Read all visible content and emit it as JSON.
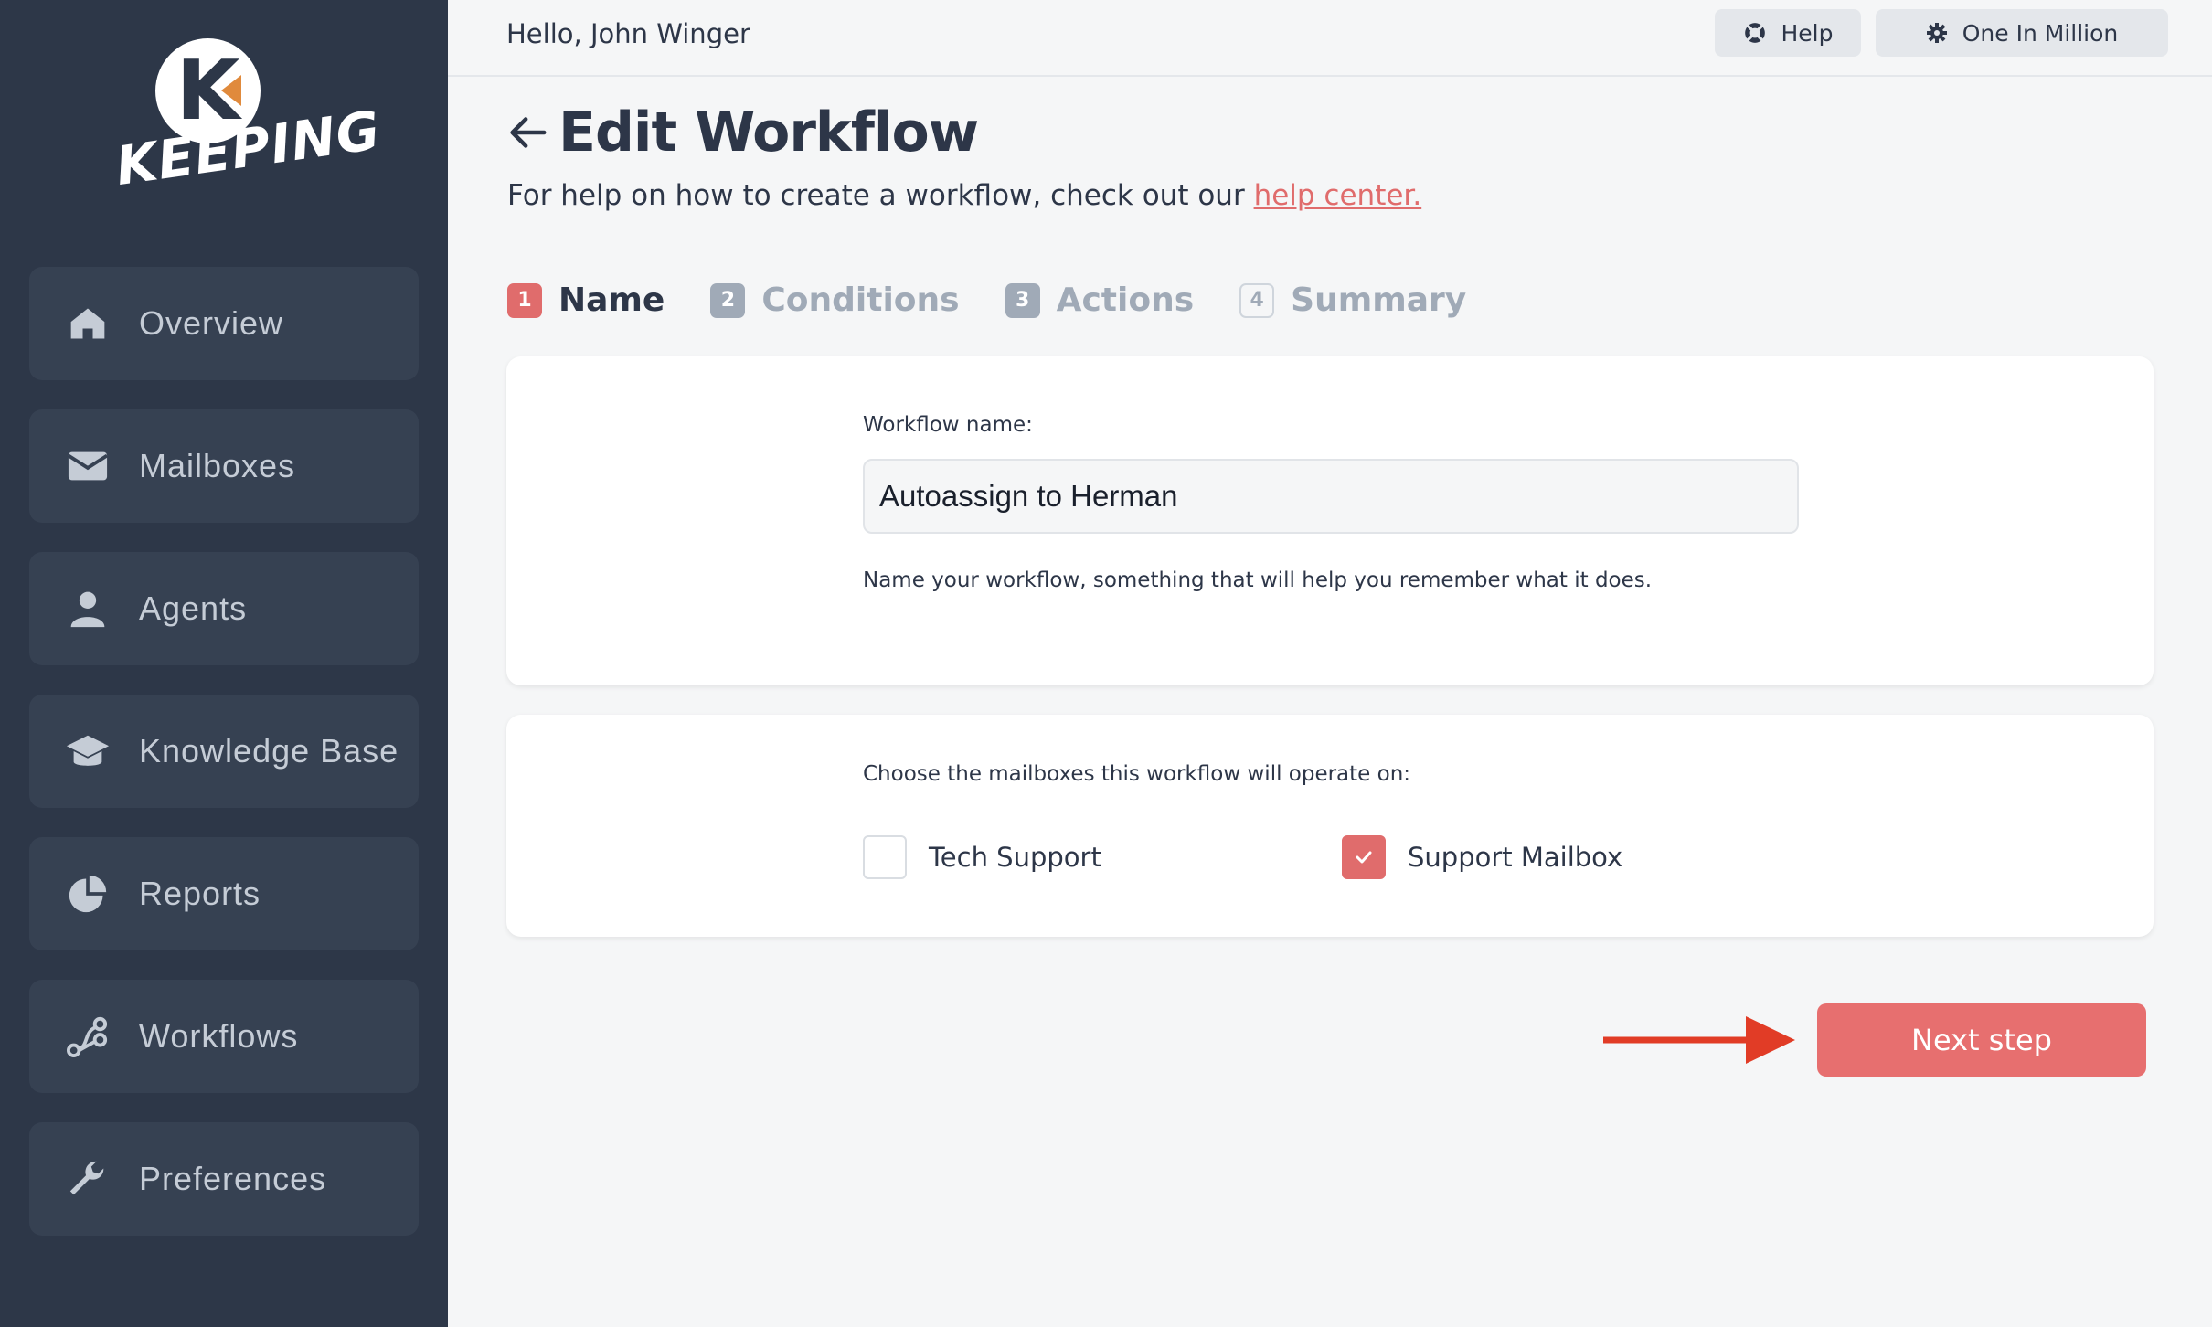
{
  "brand": {
    "name": "KEEPING",
    "initial": "K",
    "accent": "#e06c6c"
  },
  "topbar": {
    "greeting": "Hello, John Winger",
    "help_label": "Help",
    "org_label": "One In Million"
  },
  "sidebar": {
    "items": [
      {
        "label": "Overview",
        "icon": "home-icon"
      },
      {
        "label": "Mailboxes",
        "icon": "envelope-icon"
      },
      {
        "label": "Agents",
        "icon": "user-icon"
      },
      {
        "label": "Knowledge Base",
        "icon": "graduation-cap-icon"
      },
      {
        "label": "Reports",
        "icon": "pie-chart-icon"
      },
      {
        "label": "Workflows",
        "icon": "workflow-icon"
      },
      {
        "label": "Preferences",
        "icon": "wrench-icon"
      }
    ]
  },
  "page": {
    "title": "Edit Workflow",
    "subtitle_prefix": "For help on how to create a workflow, check out our ",
    "subtitle_link": "help center."
  },
  "steps": [
    {
      "num": "1",
      "label": "Name"
    },
    {
      "num": "2",
      "label": "Conditions"
    },
    {
      "num": "3",
      "label": "Actions"
    },
    {
      "num": "4",
      "label": "Summary"
    }
  ],
  "name_card": {
    "label": "Workflow name:",
    "value": "Autoassign to Herman",
    "hint": "Name your workflow, something that will help you remember what it does."
  },
  "mailbox_card": {
    "label": "Choose the mailboxes this workflow will operate on:",
    "options": [
      {
        "label": "Tech Support",
        "checked": false
      },
      {
        "label": "Support Mailbox",
        "checked": true
      }
    ]
  },
  "next_label": "Next step"
}
